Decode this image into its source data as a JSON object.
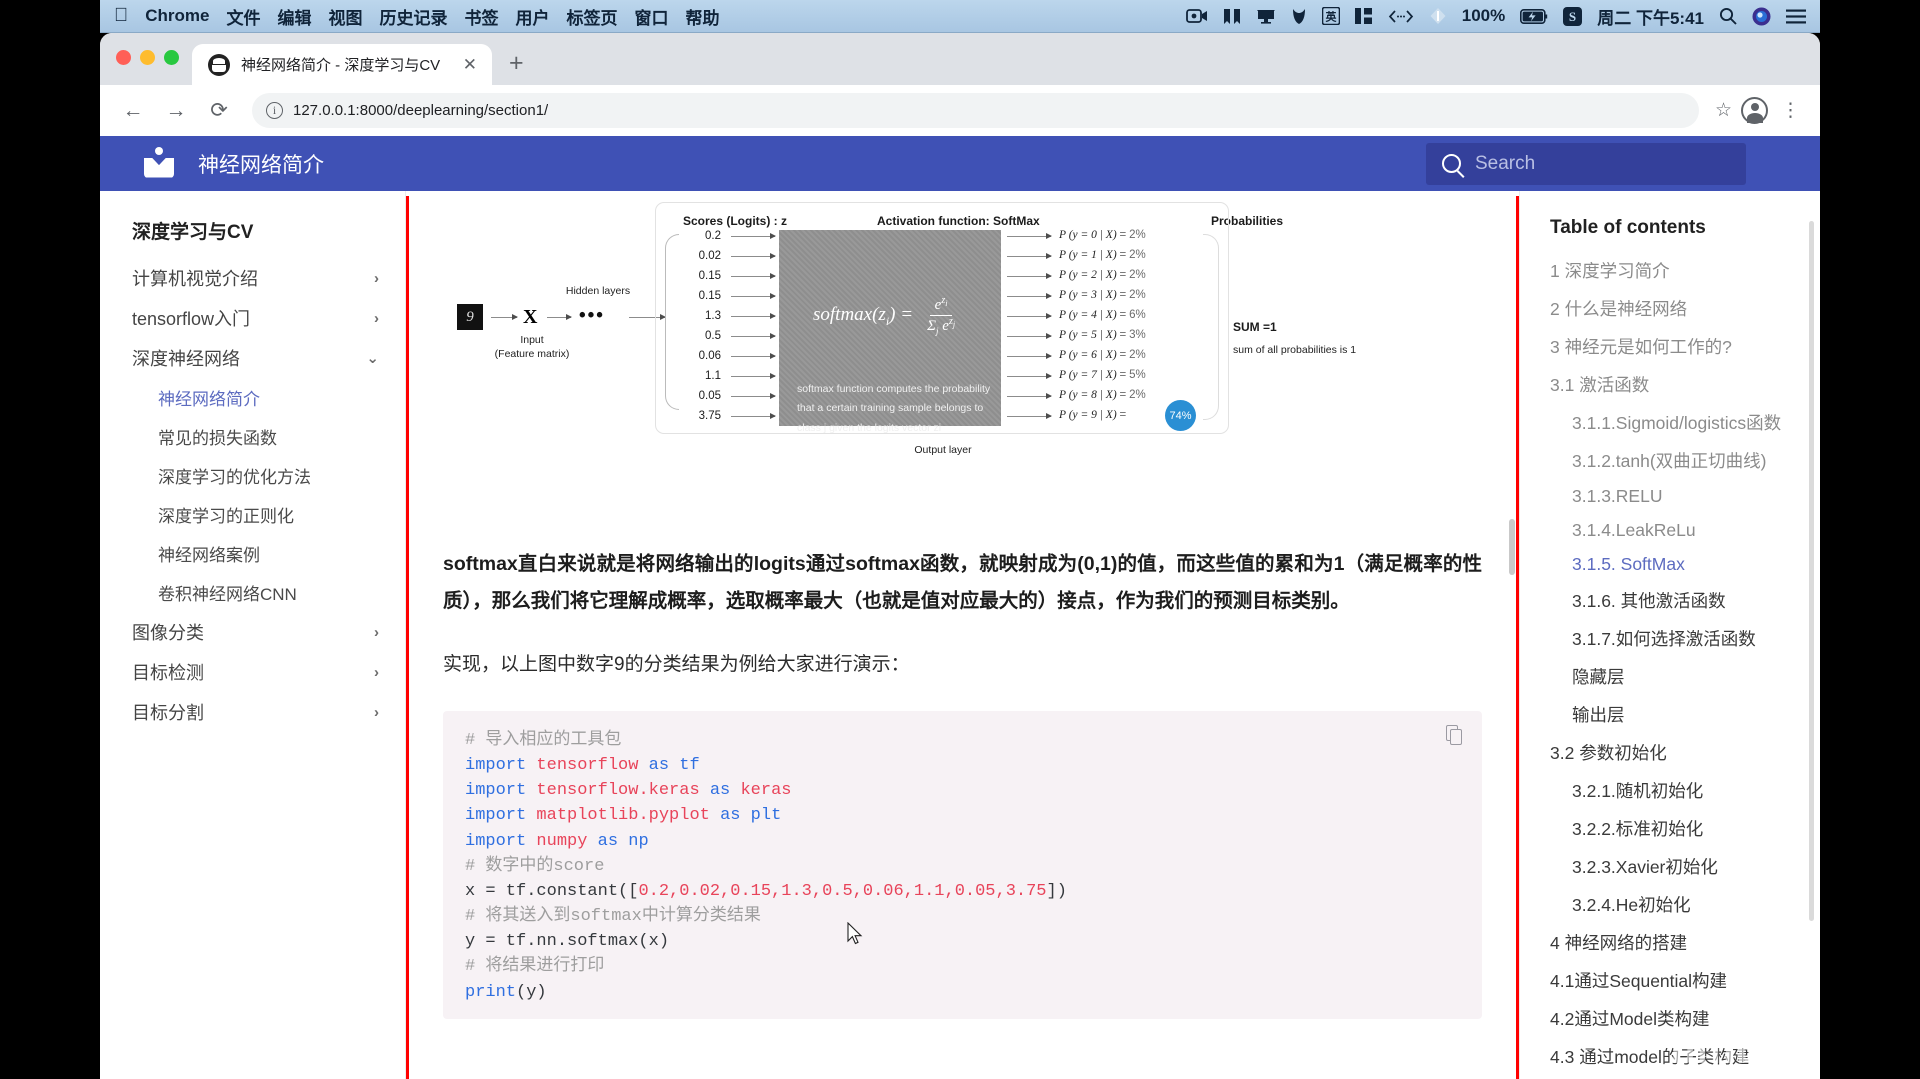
{
  "menubar": {
    "apple": "",
    "items": [
      "Chrome",
      "文件",
      "编辑",
      "视图",
      "历史记录",
      "书签",
      "用户",
      "标签页",
      "窗口",
      "帮助"
    ],
    "status_icons": [
      "screen-record-icon",
      "bartender-icon",
      "display-icon",
      "leaf-icon",
      "input-source-icon",
      "layout-icon",
      "code-icon",
      "dropbox-icon"
    ],
    "battery_percent": "100%",
    "sogou": "S",
    "clock": "周二 下午5:41",
    "right_icons": [
      "search-icon",
      "siri-icon",
      "control-center-icon"
    ]
  },
  "browser": {
    "tab": {
      "title": "神经网络简介 - 深度学习与CV",
      "close": "✕"
    },
    "newtab": "+",
    "nav": {
      "back": "←",
      "forward": "→",
      "reload": "⟳"
    },
    "omnibox": {
      "info": "i",
      "url": "127.0.0.1:8000/deeplearning/section1/"
    },
    "star": "☆",
    "kebab": "⋮"
  },
  "site": {
    "title": "神经网络简介",
    "search": {
      "placeholder": "Search"
    }
  },
  "sidebar": {
    "heading": "深度学习与CV",
    "items": [
      {
        "label": "计算机视觉介绍",
        "chevron": "›",
        "level": 1,
        "active": false
      },
      {
        "label": "tensorflow入门",
        "chevron": "›",
        "level": 1,
        "active": false
      },
      {
        "label": "深度神经网络",
        "chevron": "⌄",
        "level": 1,
        "active": false
      },
      {
        "label": "神经网络简介",
        "chevron": "",
        "level": 2,
        "active": true
      },
      {
        "label": "常见的损失函数",
        "chevron": "",
        "level": 2,
        "active": false
      },
      {
        "label": "深度学习的优化方法",
        "chevron": "",
        "level": 2,
        "active": false
      },
      {
        "label": "深度学习的正则化",
        "chevron": "",
        "level": 2,
        "active": false
      },
      {
        "label": "神经网络案例",
        "chevron": "",
        "level": 2,
        "active": false
      },
      {
        "label": "卷积神经网络CNN",
        "chevron": "",
        "level": 2,
        "active": false
      },
      {
        "label": "图像分类",
        "chevron": "›",
        "level": 1,
        "active": false
      },
      {
        "label": "目标检测",
        "chevron": "›",
        "level": 1,
        "active": false
      },
      {
        "label": "目标分割",
        "chevron": "›",
        "level": 1,
        "active": false
      }
    ]
  },
  "toc": {
    "heading": "Table of contents",
    "items": [
      {
        "label": "1 深度学习简介",
        "level": 0,
        "state": "muted"
      },
      {
        "label": "2 什么是神经网络",
        "level": 0,
        "state": "muted"
      },
      {
        "label": "3 神经元是如何工作的?",
        "level": 0,
        "state": "muted"
      },
      {
        "label": "3.1 激活函数",
        "level": 1,
        "state": "muted"
      },
      {
        "label": "3.1.1.Sigmoid/logistics函数",
        "level": 2,
        "state": "muted"
      },
      {
        "label": "3.1.2.tanh(双曲正切曲线)",
        "level": 2,
        "state": "muted"
      },
      {
        "label": "3.1.3.RELU",
        "level": 2,
        "state": "muted"
      },
      {
        "label": "3.1.4.LeakReLu",
        "level": 2,
        "state": "muted"
      },
      {
        "label": "3.1.5. SoftMax",
        "level": 2,
        "state": "active"
      },
      {
        "label": "3.1.6. 其他激活函数",
        "level": 2,
        "state": "dark"
      },
      {
        "label": "3.1.7.如何选择激活函数",
        "level": 2,
        "state": "dark"
      },
      {
        "label": "隐藏层",
        "level": 2,
        "state": "dark"
      },
      {
        "label": "输出层",
        "level": 2,
        "state": "dark"
      },
      {
        "label": "3.2 参数初始化",
        "level": 1,
        "state": "dark"
      },
      {
        "label": "3.2.1.随机初始化",
        "level": 2,
        "state": "dark"
      },
      {
        "label": "3.2.2.标准初始化",
        "level": 2,
        "state": "dark"
      },
      {
        "label": "3.2.3.Xavier初始化",
        "level": 2,
        "state": "dark"
      },
      {
        "label": "3.2.4.He初始化",
        "level": 2,
        "state": "dark"
      },
      {
        "label": "4 神经网络的搭建",
        "level": 0,
        "state": "dark"
      },
      {
        "label": "4.1通过Sequential构建",
        "level": 1,
        "state": "dark"
      },
      {
        "label": "4.2通过Model类构建",
        "level": 1,
        "state": "dark"
      },
      {
        "label": "4.3 通过model的子类构建",
        "level": 1,
        "state": "dark"
      }
    ]
  },
  "figure": {
    "col_titles": {
      "scores": "Scores (Logits) : z",
      "activation": "Activation function:  SoftMax",
      "probabilities": "Probabilities"
    },
    "input_label_1": "Input",
    "input_label_2": "(Feature matrix)",
    "input_digit": "9",
    "x_symbol": "X",
    "hidden_layers": "Hidden layers",
    "dots": "•••",
    "output_layer": "Output  layer",
    "logits": [
      "0.2",
      "0.02",
      "0.15",
      "0.15",
      "1.3",
      "0.5",
      "0.06",
      "1.1",
      "0.05",
      "3.75"
    ],
    "formula_lhs": "softmax(z",
    "formula_sub": "i",
    "formula_eq": ") =",
    "formula_num": "e^{z_i}",
    "formula_den": "Σ_j e^{z_j}",
    "desc_lines": [
      "softmax function computes the probability",
      "that a certain training sample belongs to",
      "class j given the logits vector zi"
    ],
    "probabilities": [
      {
        "label": "P (y = 0 | X)",
        "eq": "=",
        "value": "2%"
      },
      {
        "label": "P (y = 1 | X)",
        "eq": "=",
        "value": "2%"
      },
      {
        "label": "P (y = 2 | X)",
        "eq": "=",
        "value": "2%"
      },
      {
        "label": "P (y = 3 | X)",
        "eq": "=",
        "value": "2%"
      },
      {
        "label": "P (y = 4 | X)",
        "eq": "=",
        "value": "6%"
      },
      {
        "label": "P (y = 5 | X)",
        "eq": "=",
        "value": "3%"
      },
      {
        "label": "P (y = 6 | X)",
        "eq": "=",
        "value": "2%"
      },
      {
        "label": "P (y = 7 | X)",
        "eq": "=",
        "value": "5%"
      },
      {
        "label": "P (y = 8 | X)",
        "eq": "=",
        "value": "2%"
      },
      {
        "label": "P (y = 9 | X)",
        "eq": "=",
        "value": "74%"
      }
    ],
    "sum_title": "SUM =1",
    "sum_note": "sum of all probabilities is 1"
  },
  "content": {
    "para_bold": "softmax直白来说就是将网络输出的logits通过softmax函数，就映射成为(0,1)的值，而这些值的累和为1（满足概率的性质），那么我们将它理解成概率，选取概率最大（也就是值对应最大的）接点，作为我们的预测目标类别。",
    "para_normal": "实现，以上图中数字9的分类结果为例给大家进行演示："
  },
  "code": {
    "lines": [
      {
        "tokens": [
          {
            "t": "# 导入相应的工具包",
            "c": "cm"
          }
        ]
      },
      {
        "tokens": [
          {
            "t": "import ",
            "c": "kw"
          },
          {
            "t": "tensorflow ",
            "c": "mod"
          },
          {
            "t": "as ",
            "c": "kw"
          },
          {
            "t": "tf",
            "c": "kw"
          }
        ]
      },
      {
        "tokens": [
          {
            "t": "import ",
            "c": "kw"
          },
          {
            "t": "tensorflow.keras ",
            "c": "mod"
          },
          {
            "t": "as ",
            "c": "kw"
          },
          {
            "t": "keras",
            "c": "mod"
          }
        ]
      },
      {
        "tokens": [
          {
            "t": "import ",
            "c": "kw"
          },
          {
            "t": "matplotlib.pyplot ",
            "c": "mod"
          },
          {
            "t": "as ",
            "c": "kw"
          },
          {
            "t": "plt",
            "c": "kw"
          }
        ]
      },
      {
        "tokens": [
          {
            "t": "import ",
            "c": "kw"
          },
          {
            "t": "numpy ",
            "c": "mod"
          },
          {
            "t": "as ",
            "c": "kw"
          },
          {
            "t": "np",
            "c": "kw"
          }
        ]
      },
      {
        "tokens": [
          {
            "t": "# 数字中的score",
            "c": "cm"
          }
        ]
      },
      {
        "tokens": [
          {
            "t": "x = tf.constant([",
            "c": "pl"
          },
          {
            "t": "0.2,0.02,0.15,1.3,0.5,0.06,1.1,0.05,3.75",
            "c": "num"
          },
          {
            "t": "])",
            "c": "pl"
          }
        ]
      },
      {
        "tokens": [
          {
            "t": "# 将其送入到softmax中计算分类结果",
            "c": "cm"
          }
        ]
      },
      {
        "tokens": [
          {
            "t": "y = tf.nn.softmax(x)",
            "c": "pl"
          }
        ]
      },
      {
        "tokens": [
          {
            "t": "# 将结果进行打印",
            "c": "cm"
          }
        ]
      },
      {
        "tokens": [
          {
            "t": "print",
            "c": "fn"
          },
          {
            "t": "(y)",
            "c": "pl"
          }
        ]
      }
    ],
    "copy_label": "copy-icon"
  },
  "watermark": "bilibili",
  "colors": {
    "brand": "#3f51b5",
    "accent": "#5c6bc0",
    "highlight_box": "#ff0000",
    "bubble": "#2a8fd4"
  }
}
